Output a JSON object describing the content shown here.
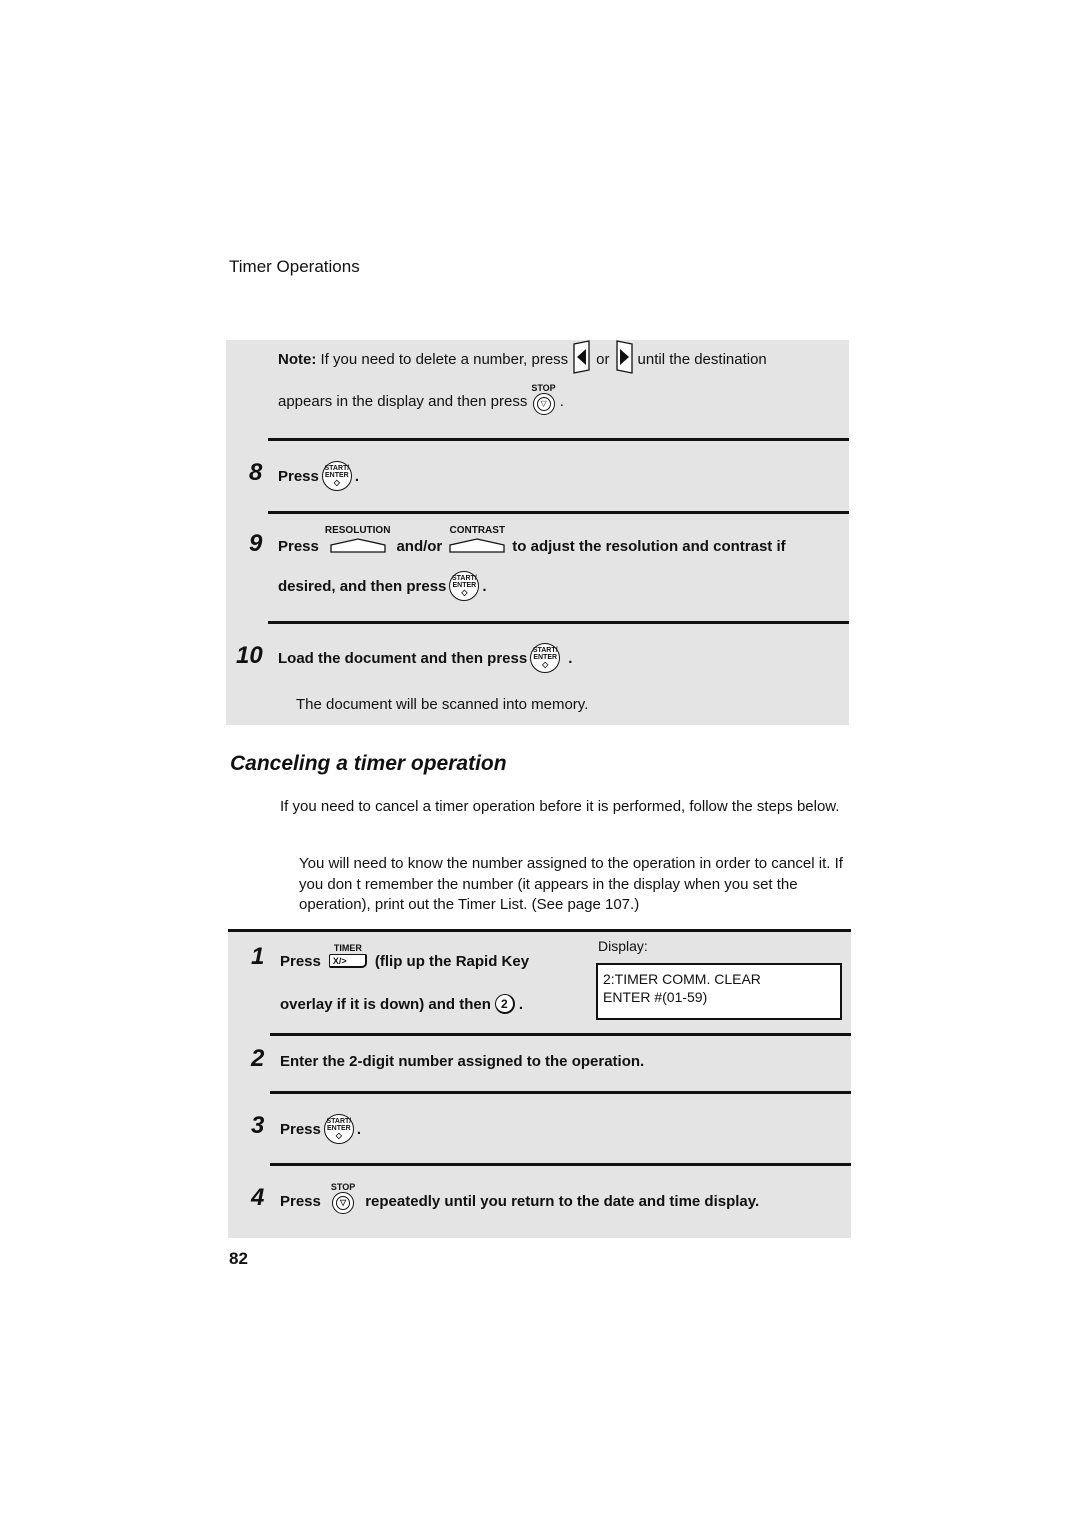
{
  "header": {
    "section_label": "Timer Operations"
  },
  "steps_box_1": {
    "note": {
      "label": "Note:",
      "text_1": "If you need to delete a number, press",
      "or": "or",
      "text_2": "until the destination",
      "text_3": "appears in the display and then press",
      "period": ".",
      "left_arrow_icon": "left-arrow-key",
      "right_arrow_icon": "right-arrow-key",
      "stop_key_label": "STOP"
    },
    "step8": {
      "num": "8",
      "press": "Press",
      "key_top": "START/",
      "key_bottom": "ENTER",
      "key_symbol": "◇",
      "period": "."
    },
    "step9": {
      "num": "9",
      "press": "Press",
      "key1_label": "RESOLUTION",
      "andor": "and/or",
      "key2_label": "CONTRAST",
      "text_1": "to adjust the resolution and contrast if",
      "text_2": "desired, and then press",
      "key_top": "START/",
      "key_bottom": "ENTER",
      "key_symbol": "◇",
      "period": "."
    },
    "step10": {
      "num": "10",
      "text": "Load the document and then press",
      "key_top": "START/",
      "key_bottom": "ENTER",
      "key_symbol": "◇",
      "period": ".",
      "result": "The document will be scanned into memory."
    }
  },
  "section": {
    "heading": "Canceling a timer operation",
    "intro": "If you need to cancel a timer operation before it is performed, follow the steps below.",
    "hint": "You will need to know the number assigned to the operation in order to cancel it. If you don t remember the number (it appears in the display when you set the operation), print out the Timer List. (See page 107.)"
  },
  "steps_box_2": {
    "step1": {
      "num": "1",
      "press": "Press",
      "key_label": "TIMER",
      "key_face": "X/>",
      "text_1": "(flip up the Rapid Key",
      "text_2": "overlay if it is down) and then",
      "digit": "2",
      "period": ".",
      "display_label": "Display:",
      "display_line_1": "2:TIMER COMM. CLEAR",
      "display_line_2": "ENTER #(01-59)"
    },
    "step2": {
      "num": "2",
      "text": "Enter the 2-digit number assigned to the operation."
    },
    "step3": {
      "num": "3",
      "press": "Press",
      "key_top": "START/",
      "key_bottom": "ENTER",
      "key_symbol": "◇",
      "period": "."
    },
    "step4": {
      "num": "4",
      "press": "Press",
      "stop_key_label": "STOP",
      "text": "repeatedly until you return to the date and time display."
    }
  },
  "footer": {
    "page_number": "82"
  }
}
